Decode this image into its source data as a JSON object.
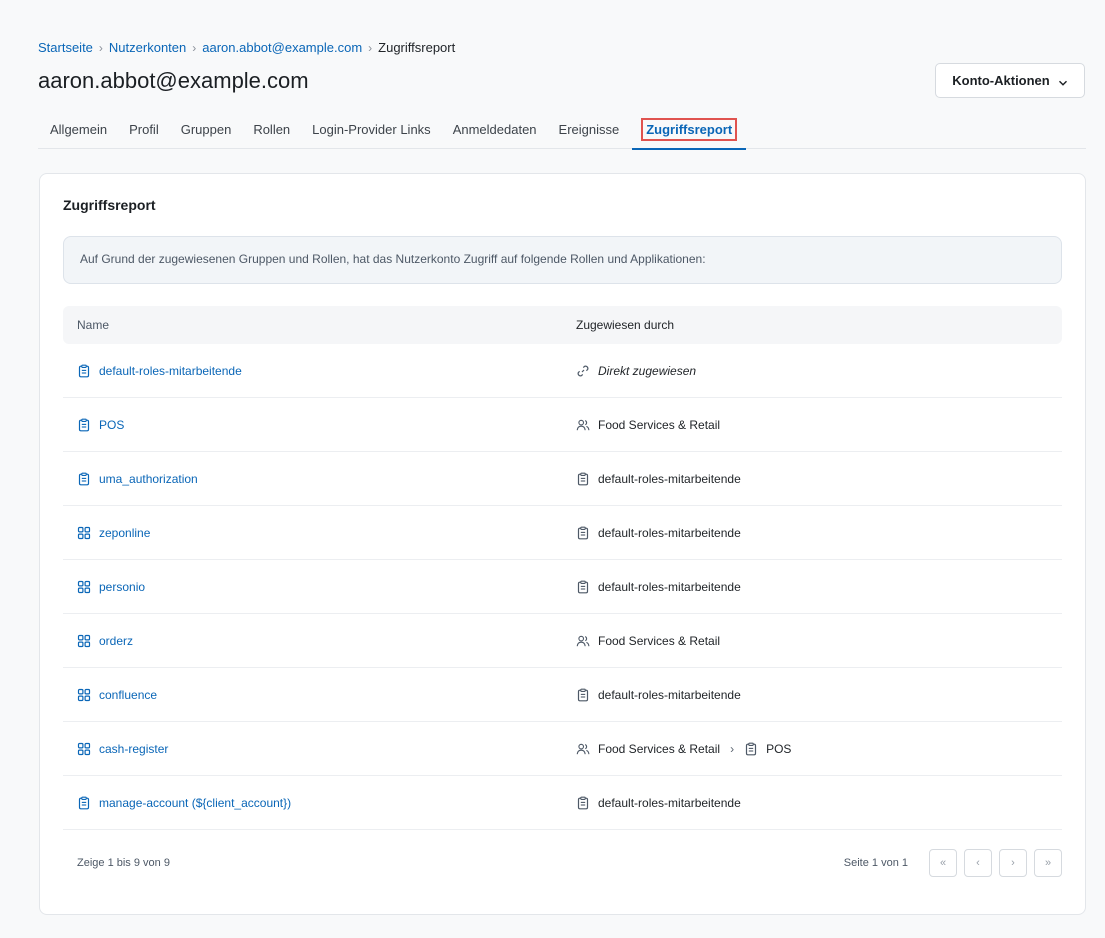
{
  "breadcrumb": {
    "home": "Startseite",
    "accounts": "Nutzerkonten",
    "user": "aaron.abbot@example.com",
    "current": "Zugriffsreport"
  },
  "header": {
    "title": "aaron.abbot@example.com",
    "actions_label": "Konto-Aktionen"
  },
  "tabs": [
    {
      "label": "Allgemein"
    },
    {
      "label": "Profil"
    },
    {
      "label": "Gruppen"
    },
    {
      "label": "Rollen"
    },
    {
      "label": "Login-Provider Links"
    },
    {
      "label": "Anmeldedaten"
    },
    {
      "label": "Ereignisse"
    },
    {
      "label": "Zugriffsreport",
      "active": true
    }
  ],
  "card": {
    "title": "Zugriffsreport",
    "info": "Auf Grund der zugewiesenen Gruppen und Rollen, hat das Nutzerkonto Zugriff auf folgende Rollen und Applikationen:"
  },
  "table": {
    "columns": [
      "Name",
      "Zugewiesen durch"
    ],
    "rows": [
      {
        "name": "default-roles-mitarbeitende",
        "icon": "role-icon",
        "via": [
          {
            "icon": "link-icon",
            "text": "Direkt zugewiesen",
            "italic": true
          }
        ]
      },
      {
        "name": "POS",
        "icon": "role-icon",
        "via": [
          {
            "icon": "group-icon",
            "text": "Food Services & Retail"
          }
        ]
      },
      {
        "name": "uma_authorization",
        "icon": "role-icon",
        "via": [
          {
            "icon": "role-icon",
            "text": "default-roles-mitarbeitende"
          }
        ]
      },
      {
        "name": "zeponline",
        "icon": "app-icon",
        "via": [
          {
            "icon": "role-icon",
            "text": "default-roles-mitarbeitende"
          }
        ]
      },
      {
        "name": "personio",
        "icon": "app-icon",
        "via": [
          {
            "icon": "role-icon",
            "text": "default-roles-mitarbeitende"
          }
        ]
      },
      {
        "name": "orderz",
        "icon": "app-icon",
        "via": [
          {
            "icon": "group-icon",
            "text": "Food Services & Retail"
          }
        ]
      },
      {
        "name": "confluence",
        "icon": "app-icon",
        "via": [
          {
            "icon": "role-icon",
            "text": "default-roles-mitarbeitende"
          }
        ]
      },
      {
        "name": "cash-register",
        "icon": "app-icon",
        "via": [
          {
            "icon": "group-icon",
            "text": "Food Services & Retail"
          },
          {
            "icon": "role-icon",
            "text": "POS"
          }
        ]
      },
      {
        "name": "manage-account (${client_account})",
        "icon": "role-icon",
        "via": [
          {
            "icon": "role-icon",
            "text": "default-roles-mitarbeitende"
          }
        ]
      }
    ]
  },
  "footer": {
    "summary": "Zeige 1 bis 9 von 9",
    "page_info": "Seite 1 von 1",
    "first": "«",
    "prev": "‹",
    "next": "›",
    "last": "»"
  }
}
